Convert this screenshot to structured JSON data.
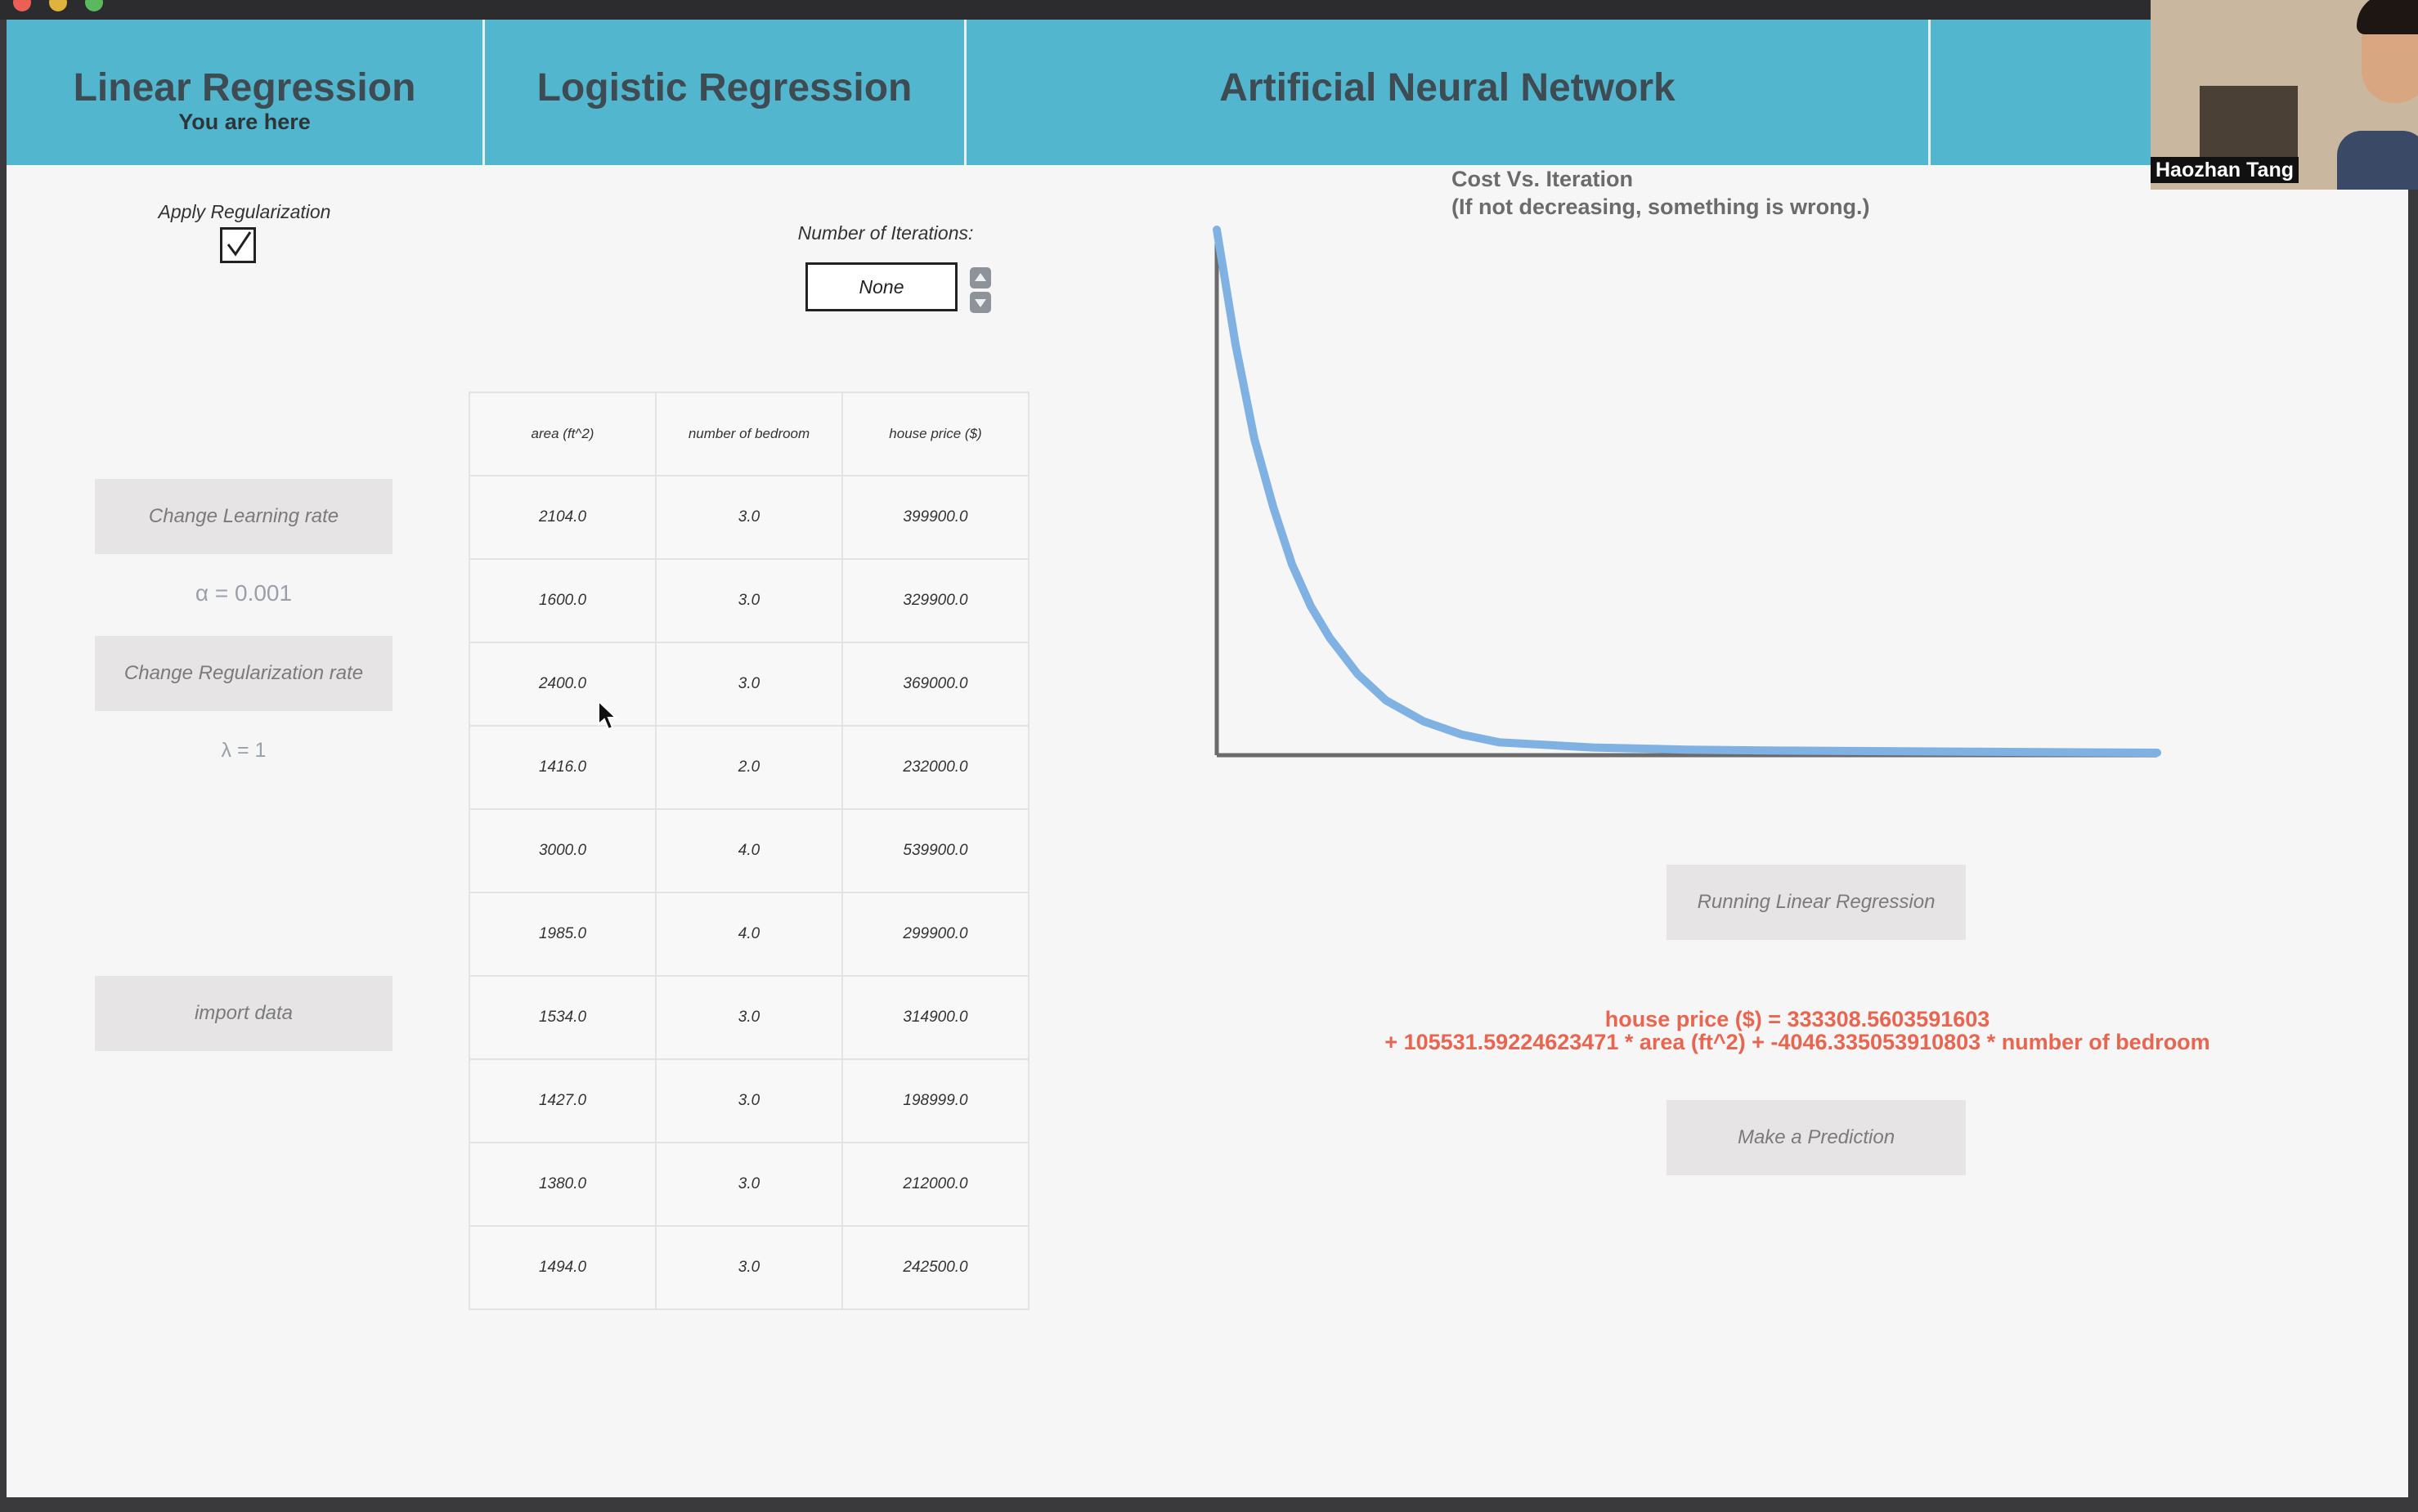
{
  "nav": {
    "tabs": [
      {
        "label": "Linear Regression",
        "sublabel": "You are here"
      },
      {
        "label": "Logistic Regression"
      },
      {
        "label": "Artificial Neural Network"
      }
    ]
  },
  "sidebar": {
    "regularization_label": "Apply Regularization",
    "regularization_checked": true,
    "learning_rate_button": "Change Learning rate",
    "alpha_display": "α = 0.001",
    "regularization_rate_button": "Change Regularization rate",
    "lambda_display": "λ = 1",
    "import_button": "import data"
  },
  "iterations": {
    "label": "Number of Iterations:",
    "value": "None"
  },
  "table": {
    "headers": [
      "area (ft^2)",
      "number of bedroom",
      "house price ($)"
    ],
    "rows": [
      [
        "2104.0",
        "3.0",
        "399900.0"
      ],
      [
        "1600.0",
        "3.0",
        "329900.0"
      ],
      [
        "2400.0",
        "3.0",
        "369000.0"
      ],
      [
        "1416.0",
        "2.0",
        "232000.0"
      ],
      [
        "3000.0",
        "4.0",
        "539900.0"
      ],
      [
        "1985.0",
        "4.0",
        "299900.0"
      ],
      [
        "1534.0",
        "3.0",
        "314900.0"
      ],
      [
        "1427.0",
        "3.0",
        "198999.0"
      ],
      [
        "1380.0",
        "3.0",
        "212000.0"
      ],
      [
        "1494.0",
        "3.0",
        "242500.0"
      ]
    ]
  },
  "chart": {
    "title": "Cost Vs. Iteration",
    "subtitle": "(If not decreasing, something is wrong.)",
    "line_color": "#7fb2e3",
    "axis_color": "#6b6b6b"
  },
  "chart_data": {
    "type": "line",
    "title": "Cost Vs. Iteration",
    "subtitle": "(If not decreasing, something is wrong.)",
    "xlabel": "",
    "ylabel": "",
    "grid": false,
    "series": [
      {
        "x": [
          0,
          0.02,
          0.04,
          0.06,
          0.08,
          0.1,
          0.12,
          0.15,
          0.18,
          0.22,
          0.26,
          0.3,
          0.4,
          0.5,
          0.6,
          0.8,
          1.0
        ],
        "values": [
          1.0,
          0.78,
          0.6,
          0.47,
          0.36,
          0.28,
          0.22,
          0.15,
          0.1,
          0.06,
          0.035,
          0.02,
          0.01,
          0.006,
          0.004,
          0.002,
          0.0
        ]
      }
    ]
  },
  "actions": {
    "run_button": "Running Linear Regression",
    "predict_button": "Make a Prediction",
    "equation_line1": "house price ($) = 333308.5603591603",
    "equation_line2": "+ 105531.59224623471 * area (ft^2) + -4046.335053910803 * number of bedroom"
  },
  "webcam": {
    "participant_name": "Haozhan Tang"
  }
}
